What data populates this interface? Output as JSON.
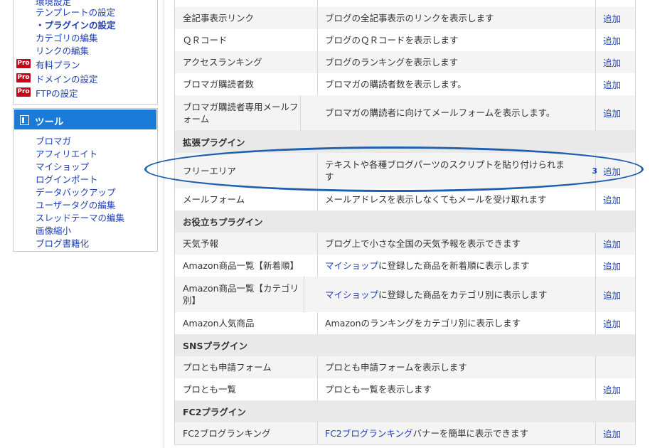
{
  "sidebar": {
    "blog_links": [
      {
        "label": "環境設定"
      },
      {
        "label": "テンプレートの設定"
      },
      {
        "label": "・プラグインの設定"
      },
      {
        "label": "カテゴリの編集"
      },
      {
        "label": "リンクの編集"
      }
    ],
    "pro_badge": "Pro",
    "pro_links": [
      {
        "label": "有料プラン"
      },
      {
        "label": "ドメインの設定"
      },
      {
        "label": "FTPの設定"
      }
    ],
    "tools_title": "ツール",
    "tool_links": [
      {
        "label": "ブロマガ"
      },
      {
        "label": "アフィリエイト"
      },
      {
        "label": "マイショップ"
      },
      {
        "label": "ログインポート"
      },
      {
        "label": "データバックアップ"
      },
      {
        "label": "ユーザータグの編集"
      },
      {
        "label": "スレッドテーマの編集"
      },
      {
        "label": "画像縮小"
      },
      {
        "label": "ブログ書籍化"
      }
    ]
  },
  "table": {
    "add_label": "追加",
    "rows": [
      {
        "name": "全記事表示リンク",
        "desc": "ブログの全記事表示のリンクを表示します"
      },
      {
        "name": "ＱＲコード",
        "desc": "ブログのＱＲコードを表示します"
      },
      {
        "name": "アクセスランキング",
        "desc": "ブログのランキングを表示します"
      },
      {
        "name": "ブロマガ購読者数",
        "desc": "ブロマガの購読者数を表示します。"
      },
      {
        "name": "ブロマガ購読者専用メールフォーム",
        "desc": "ブロマガの購読者に向けてメールフォームを表示します。"
      }
    ],
    "section_ext": "拡張プラグイン",
    "ext_rows": [
      {
        "name": "フリーエリア",
        "desc": "テキストや各種ブログパーツのスクリプトを貼り付けられます",
        "count": "3"
      },
      {
        "name": "メールフォーム",
        "desc": "メールアドレスを表示しなくてもメールを受け取れます"
      }
    ],
    "section_useful": "お役立ちプラグイン",
    "useful_rows": [
      {
        "name": "天気予報",
        "desc": "ブログ上で小さな全国の天気予報を表示できます"
      },
      {
        "name": "Amazon商品一覧【新着順】",
        "link": "マイショップ",
        "desc": "に登録した商品を新着順に表示します"
      },
      {
        "name": "Amazon商品一覧【カテゴリ別】",
        "link": "マイショップ",
        "desc": "に登録した商品をカテゴリ別に表示します"
      },
      {
        "name": "Amazon人気商品",
        "desc": "Amazonのランキングをカテゴリ別に表示します"
      }
    ],
    "section_sns": "SNSプラグイン",
    "sns_rows": [
      {
        "name": "プロとも申請フォーム",
        "desc": "プロとも申請フォームを表示します"
      },
      {
        "name": "プロとも一覧",
        "desc": "プロとも一覧を表示します"
      }
    ],
    "section_fc2": "FC2プラグイン",
    "fc2_rows": [
      {
        "name": "FC2ブログランキング",
        "link": "FC2ブログランキング",
        "desc": "バナーを簡単に表示できます"
      }
    ]
  },
  "colors": {
    "link": "#1d3fb8",
    "tool_header": "#1a7bd9",
    "pro_badge": "#d0021b",
    "annotation": "#1e5fae"
  }
}
